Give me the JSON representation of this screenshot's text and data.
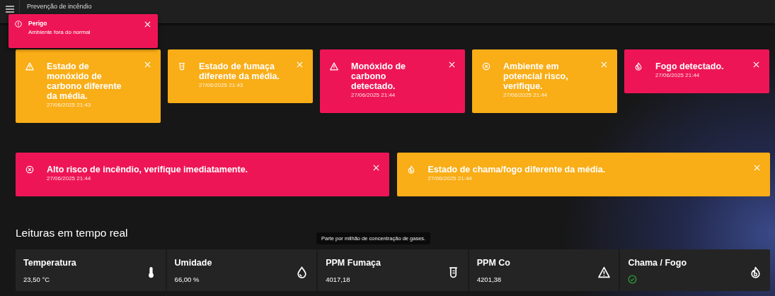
{
  "app_bar": {
    "title": "Prevenção de incêndio"
  },
  "toast": {
    "title": "Perigo",
    "message": "Ambiente fora do normal",
    "color": "#ee1556"
  },
  "alerts": [
    {
      "kind": "co",
      "color": "#f9ad16",
      "title": "Estado de monóxido de carbono diferente da média.",
      "time": "27/06/2025 21:43"
    },
    {
      "kind": "smoke",
      "color": "#f9ad16",
      "title": "Estado de fumaça diferente da média.",
      "time": "27/06/2025 21:43"
    },
    {
      "kind": "co",
      "color": "#ee1556",
      "title": "Monóxido de carbono detectado.",
      "time": "27/06/2025 21:44"
    },
    {
      "kind": "risk",
      "color": "#f9ad16",
      "title": "Ambiente em potencial risco, verifique.",
      "time": "27/06/2025 21:44"
    },
    {
      "kind": "fire",
      "color": "#ee1556",
      "title": "Fogo detectado.",
      "time": "27/06/2025 21:44"
    },
    {
      "kind": "risk",
      "color": "#ee1556",
      "title": "Alto risco de incêndio, verifique imediatamente.",
      "time": "27/06/2025 21:44"
    },
    {
      "kind": "fire",
      "color": "#f9ad16",
      "title": "Estado de chama/fogo diferente da média.",
      "time": "27/06/2025 21:44"
    }
  ],
  "readings_heading": "Leituras em tempo real",
  "tooltip": "Parte por milhão de concentração de gases.",
  "readings": [
    {
      "kind": "temp",
      "label": "Temperatura",
      "value": "23,50 °C"
    },
    {
      "kind": "humidity",
      "label": "Umidade",
      "value": "66,00 %"
    },
    {
      "kind": "smoke",
      "label": "PPM Fumaça",
      "value": "4017,18"
    },
    {
      "kind": "co",
      "label": "PPM Co",
      "value": "4201,38"
    },
    {
      "kind": "fire",
      "label": "Chama / Fogo",
      "fire_detected": false
    }
  ]
}
